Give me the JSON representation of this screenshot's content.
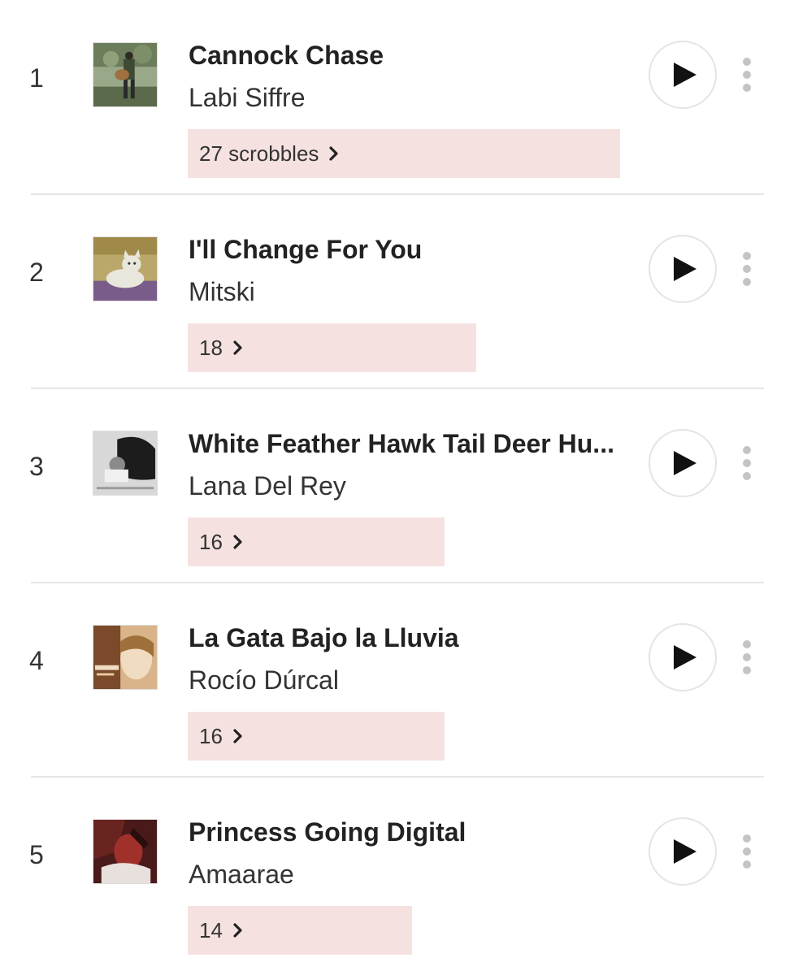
{
  "tracks": [
    {
      "rank": "1",
      "title": "Cannock Chase",
      "artist": "Labi Siffre",
      "scrobbles": "27 scrobbles",
      "art_colors": [
        "#6b7d5a",
        "#9aa88a",
        "#3e4a34"
      ]
    },
    {
      "rank": "2",
      "title": "I'll Change For You",
      "artist": "Mitski",
      "scrobbles": "18",
      "art_colors": [
        "#b9a86a",
        "#e9e6dc",
        "#7a5c8a"
      ]
    },
    {
      "rank": "3",
      "title": "White Feather Hawk Tail Deer Hu...",
      "artist": "Lana Del Rey",
      "scrobbles": "16",
      "art_colors": [
        "#d8d8d8",
        "#1c1c1c",
        "#8a8a8a"
      ]
    },
    {
      "rank": "4",
      "title": "La Gata Bajo la Lluvia",
      "artist": "Rocío Dúrcal",
      "scrobbles": "16",
      "art_colors": [
        "#7a4a2a",
        "#d9b38a",
        "#f0dcc0"
      ]
    },
    {
      "rank": "5",
      "title": "Princess Going Digital",
      "artist": "Amaarae",
      "scrobbles": "14",
      "art_colors": [
        "#4a1a1a",
        "#a0302a",
        "#e8e0dc"
      ]
    }
  ],
  "icons": {
    "play": "play-icon",
    "more": "more-vertical-icon",
    "chevron": "chevron-right-icon"
  },
  "colors": {
    "scrobble_bar": "#f6e1e1",
    "divider": "#e6e6e6",
    "text_primary": "#222222"
  },
  "scrobble_bar_fill": [
    1.0,
    0.669,
    0.594,
    0.594,
    0.519
  ]
}
